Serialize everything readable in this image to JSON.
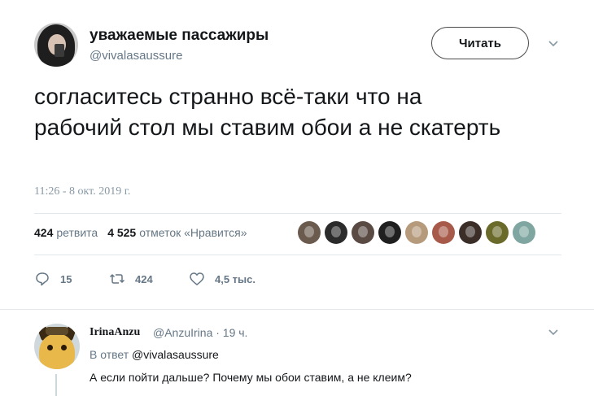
{
  "tweet": {
    "display_name": "уважаемые пассажиры",
    "handle": "@vivalasaussure",
    "follow_label": "Читать",
    "text": "согласитесь странно всё-таки что на рабочий стол мы ставим обои а не скатерть",
    "timestamp": "11:26 - 8 окт. 2019 г."
  },
  "stats": {
    "retweets_count": "424",
    "retweets_label": "ретвита",
    "likes_count": "4 525",
    "likes_label": "отметок «Нравится»"
  },
  "likers": [
    {
      "color": "#6b5a4e"
    },
    {
      "color": "#2b2b2b"
    },
    {
      "color": "#5a4a44"
    },
    {
      "color": "#1f1f1f"
    },
    {
      "color": "#b59a7c"
    },
    {
      "color": "#a85a4a"
    },
    {
      "color": "#3b2e28"
    },
    {
      "color": "#6a6a2a"
    },
    {
      "color": "#7fa6a0"
    }
  ],
  "actions": {
    "reply_count": "15",
    "retweet_count": "424",
    "like_count": "4,5 тыс."
  },
  "reply": {
    "name": "IrinaAnzu",
    "handle_time": "@AnzuIrina · 19 ч.",
    "reply_to_prefix": "В ответ",
    "reply_to_mention": "@vivalasaussure",
    "text": "А если пойти дальше? Почему мы обои ставим, а не клеим?"
  },
  "colors": {
    "text": "#14171a",
    "secondary": "#657786",
    "divider": "#e1e8ed"
  }
}
